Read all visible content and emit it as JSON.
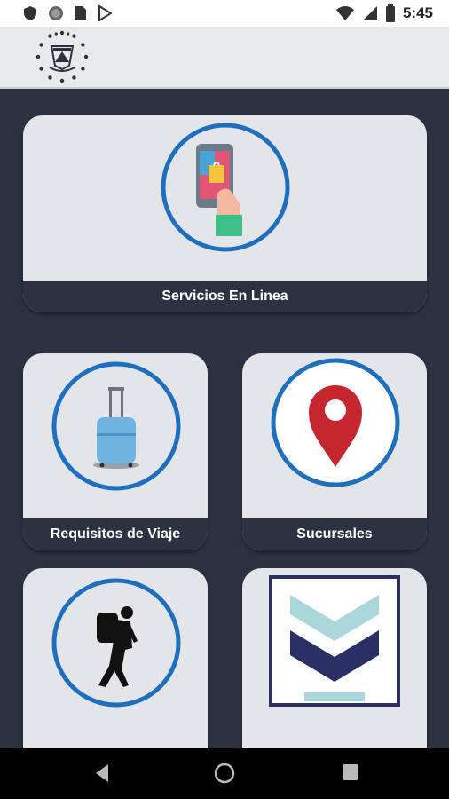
{
  "status_bar": {
    "time": "5:45",
    "left_icons": [
      "shield-icon",
      "circle-icon",
      "sim-card-icon",
      "play-store-icon"
    ],
    "right_icons": [
      "wifi-icon",
      "signal-icon",
      "battery-icon"
    ]
  },
  "app_bar": {
    "logo": "coat-of-arms-logo"
  },
  "cards": [
    {
      "label": "Servicios En Linea",
      "icon": "phone-shopping-icon"
    },
    {
      "label": "Requisitos de Viaje",
      "icon": "luggage-icon"
    },
    {
      "label": "Sucursales",
      "icon": "location-pin-icon"
    },
    {
      "label": "",
      "icon": "backpacker-icon"
    },
    {
      "label": "",
      "icon": "chevron-logo-icon"
    }
  ],
  "nav_bar": {
    "buttons": [
      "back-button",
      "home-button",
      "recents-button"
    ]
  },
  "colors": {
    "background": "#2c3241",
    "card": "#e4e5e9",
    "accent_ring": "#1f6fc0",
    "pin_red": "#c6262e",
    "luggage_blue": "#6fb3e0"
  }
}
